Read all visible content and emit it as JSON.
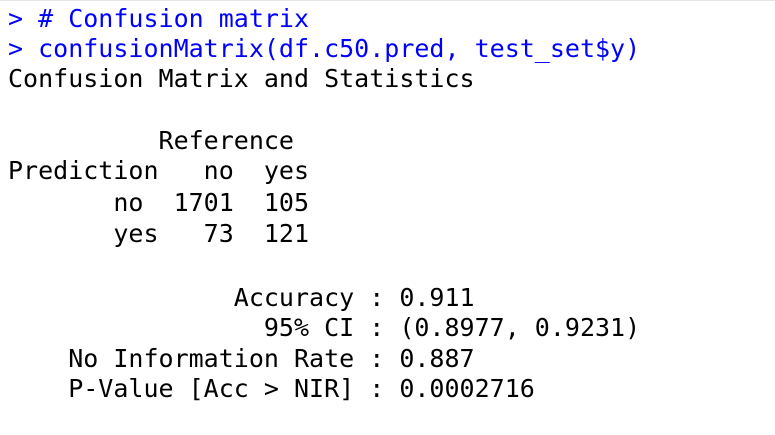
{
  "console": {
    "commands": [
      "> # Confusion matrix",
      "> confusionMatrix(df.c50.pred, test_set$y)"
    ],
    "output": {
      "heading": "Confusion Matrix and Statistics",
      "matrix_lines": [
        "          Reference",
        "Prediction   no  yes",
        "       no  1701  105",
        "       yes   73  121"
      ],
      "stats_lines": [
        "               Accuracy : 0.911",
        "                 95% CI : (0.8977, 0.9231)",
        "    No Information Rate : 0.887",
        "    P-Value [Acc > NIR] : 0.0002716"
      ]
    }
  },
  "colors": {
    "command_text": "#0000ff",
    "output_text": "#000000",
    "background": "#ffffff"
  }
}
